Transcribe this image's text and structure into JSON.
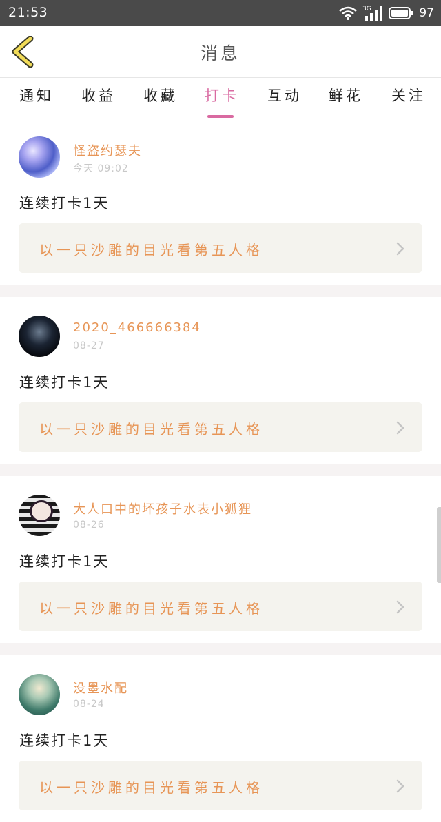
{
  "status_bar": {
    "time": "21:53",
    "network": "3G",
    "battery": "97"
  },
  "header": {
    "title": "消息"
  },
  "tabs": [
    {
      "label": "通知",
      "active": false
    },
    {
      "label": "收益",
      "active": false
    },
    {
      "label": "收藏",
      "active": false
    },
    {
      "label": "打卡",
      "active": true
    },
    {
      "label": "互动",
      "active": false
    },
    {
      "label": "鲜花",
      "active": false
    },
    {
      "label": "关注",
      "active": false
    }
  ],
  "feed": [
    {
      "username": "怪盗约瑟夫",
      "time": "今天 09:02",
      "streak": "连续打卡1天",
      "article": "以一只沙雕的目光看第五人格"
    },
    {
      "username": "2020_466666384",
      "time": "08-27",
      "streak": "连续打卡1天",
      "article": "以一只沙雕的目光看第五人格"
    },
    {
      "username": "大人口中的坏孩子水表小狐狸",
      "time": "08-26",
      "streak": "连续打卡1天",
      "article": "以一只沙雕的目光看第五人格"
    },
    {
      "username": "没墨水配",
      "time": "08-24",
      "streak": "连续打卡1天",
      "article": "以一只沙雕的目光看第五人格"
    }
  ],
  "colors": {
    "accent": "#d96aa1",
    "username": "#e79556",
    "article_bg": "#f4f3ee",
    "status_bar_bg": "#4a4a4a"
  },
  "icons": {
    "back": "chevron-left-icon",
    "article_arrow": "chevron-right-icon",
    "wifi": "wifi-icon",
    "signal": "signal-icon",
    "battery": "battery-icon"
  }
}
